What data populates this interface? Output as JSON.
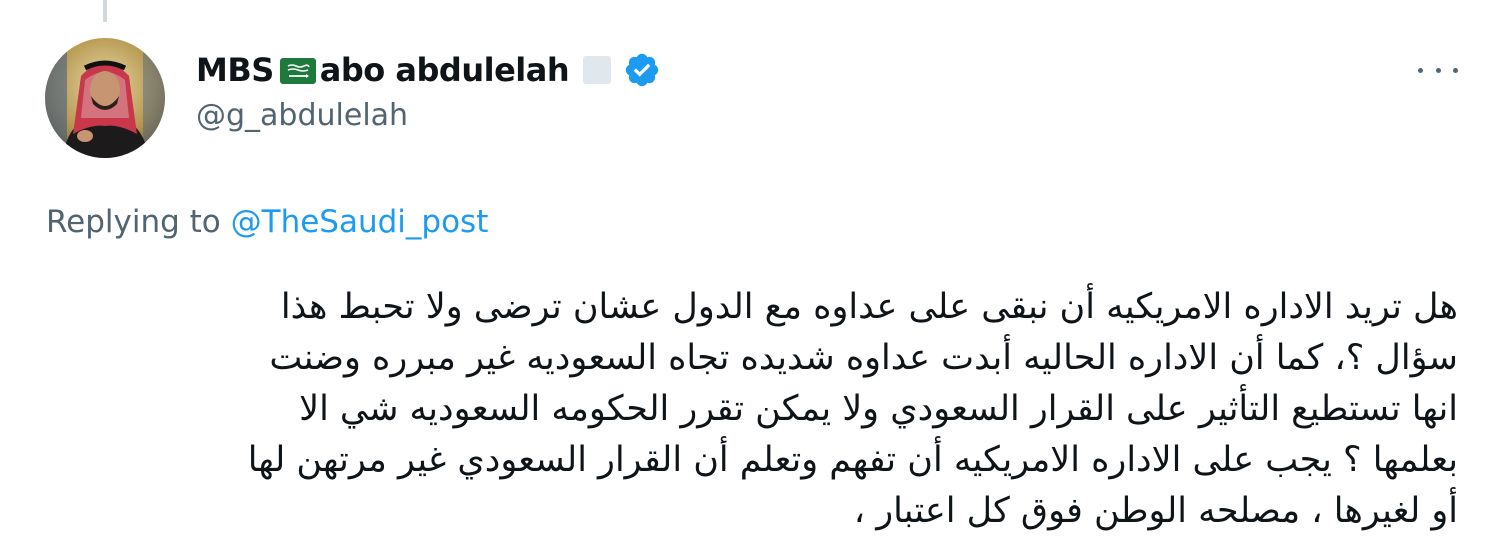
{
  "author": {
    "display_name_prefix": "MBS",
    "display_name_suffix": "abo abdulelah",
    "handle": "@g_abdulelah",
    "flag_icon": "saudi-flag-emoji",
    "verified_icon": "verified-badge-icon",
    "verified_color": "#1d9bf0"
  },
  "more_menu_icon": "more-options-icon",
  "reply_context": {
    "prefix": "Replying to",
    "mention": "@TheSaudi_post"
  },
  "tweet": {
    "lines": [
      "هل تريد الاداره الامريكيه أن نبقى على عداوه مع الدول عشان ترضى ولا تحبط هذا",
      "سؤال ؟، كما أن الاداره الحاليه أبدت عداوه شديده تجاه السعوديه غير مبرره وضنت",
      "انها تستطيع التأثير على القرار السعودي ولا يمكن تقرر الحكومه السعوديه شي الا",
      "بعلمها ؟ يجب على الاداره الامريكيه أن تفهم وتعلم أن القرار السعودي غير مرتهن لها",
      "أو لغيرها ، مصلحه الوطن فوق كل اعتبار ،"
    ]
  },
  "colors": {
    "text_primary": "#0f1419",
    "text_secondary": "#536471",
    "link": "#1d9bf0",
    "thread_line": "#cfd9de"
  }
}
